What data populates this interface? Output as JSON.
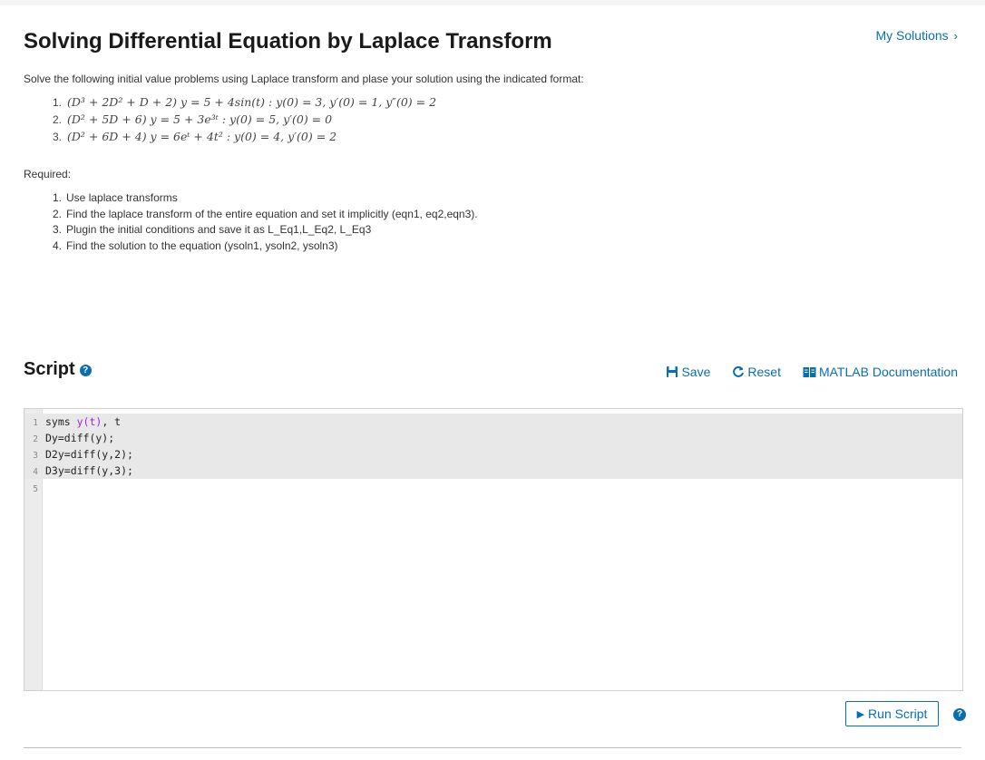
{
  "header": {
    "title": "Solving Differential Equation by Laplace Transform",
    "my_solutions": "My Solutions"
  },
  "problem": {
    "intro": "Solve the following initial value problems using Laplace transform and plase your solution using the indicated format:",
    "equations": [
      {
        "num": "1.",
        "lhs": "(D³ + 2D² + D + 2) y = 5 + 4sin(t) : y(0) = 3, y′(0) = 1, y″(0) = 2"
      },
      {
        "num": "2.",
        "lhs": "(D² + 5D + 6) y = 5 + 3e³ᵗ : y(0) = 5, y′(0) = 0"
      },
      {
        "num": "3.",
        "lhs": "(D² + 6D + 4) y = 6eᵗ + 4t² : y(0) = 4, y′(0) = 2"
      }
    ],
    "required_label": "Required:",
    "required": [
      {
        "num": "1.",
        "text": "Use laplace transforms"
      },
      {
        "num": "2.",
        "text": "Find the laplace transform of the entire equation and set it implicitly (eqn1, eq2,eqn3)."
      },
      {
        "num": "3.",
        "text": "Plugin the initial conditions and save it as L_Eq1,L_Eq2, L_Eq3"
      },
      {
        "num": "4.",
        "text": "Find the solution to the equation (ysoln1, ysoln2, ysoln3)"
      }
    ]
  },
  "script": {
    "title": "Script",
    "save_label": "Save",
    "reset_label": "Reset",
    "docs_label": "MATLAB Documentation",
    "lines": [
      {
        "n": "1",
        "pre": "syms ",
        "kw": "y(t)",
        "post": ", t"
      },
      {
        "n": "2",
        "pre": "Dy=diff(y);",
        "kw": "",
        "post": ""
      },
      {
        "n": "3",
        "pre": "D2y=diff(y,2);",
        "kw": "",
        "post": ""
      },
      {
        "n": "4",
        "pre": "D3y=diff(y,3);",
        "kw": "",
        "post": ""
      },
      {
        "n": "5",
        "pre": "",
        "kw": "",
        "post": ""
      }
    ],
    "run_label": "Run Script"
  },
  "colors": {
    "accent": "#0a6fad",
    "keyword": "#a020f0"
  }
}
